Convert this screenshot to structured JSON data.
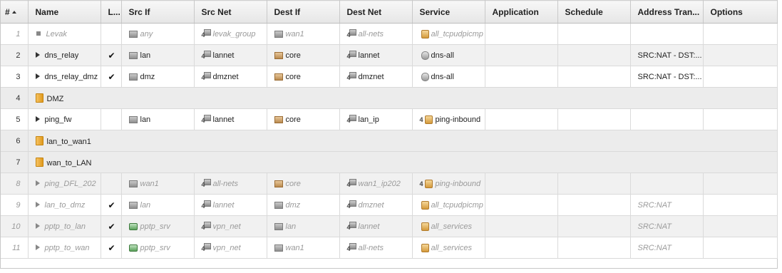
{
  "columns": [
    "#",
    "Name",
    "L...",
    "Src If",
    "Src Net",
    "Dest If",
    "Dest Net",
    "Service",
    "Application",
    "Schedule",
    "Address Tran...",
    "Options"
  ],
  "rows": [
    {
      "num": "1",
      "type": "rule",
      "disabled": true,
      "marker": "square",
      "name": "Levak",
      "log": false,
      "src_if": "any",
      "src_if_icon": "interface",
      "src_net": "levak_group",
      "dest_if": "wan1",
      "dest_if_icon": "interface",
      "dest_net": "all-nets",
      "service": "all_tcpudpicmp",
      "service_icon": "service",
      "nat": ""
    },
    {
      "num": "2",
      "type": "rule",
      "disabled": false,
      "marker": "arrow",
      "name": "dns_relay",
      "log": true,
      "src_if": "lan",
      "src_if_icon": "interface",
      "src_net": "lannet",
      "dest_if": "core",
      "dest_if_icon": "core",
      "dest_net": "lannet",
      "service": "dns-all",
      "service_icon": "service-round",
      "nat": "SRC:NAT - DST:..."
    },
    {
      "num": "3",
      "type": "rule",
      "disabled": false,
      "marker": "arrow",
      "name": "dns_relay_dmz",
      "log": true,
      "src_if": "dmz",
      "src_if_icon": "interface",
      "src_net": "dmznet",
      "dest_if": "core",
      "dest_if_icon": "core",
      "dest_net": "dmznet",
      "service": "dns-all",
      "service_icon": "service-round",
      "nat": "SRC:NAT - DST:..."
    },
    {
      "num": "4",
      "type": "folder",
      "name": "DMZ"
    },
    {
      "num": "5",
      "type": "rule",
      "disabled": false,
      "marker": "arrow",
      "name": "ping_fw",
      "log": false,
      "src_if": "lan",
      "src_if_icon": "interface",
      "src_net": "lannet",
      "dest_if": "core",
      "dest_if_icon": "core",
      "dest_net": "lan_ip",
      "service": "ping-inbound",
      "service_icon": "service-4",
      "nat": ""
    },
    {
      "num": "6",
      "type": "folder",
      "name": "lan_to_wan1"
    },
    {
      "num": "7",
      "type": "folder",
      "name": "wan_to_LAN"
    },
    {
      "num": "8",
      "type": "rule",
      "disabled": true,
      "marker": "arrow",
      "name": "ping_DFL_202",
      "log": false,
      "src_if": "wan1",
      "src_if_icon": "interface",
      "src_net": "all-nets",
      "dest_if": "core",
      "dest_if_icon": "core",
      "dest_net": "wan1_ip202",
      "service": "ping-inbound",
      "service_icon": "service-4",
      "nat": ""
    },
    {
      "num": "9",
      "type": "rule",
      "disabled": true,
      "marker": "arrow",
      "name": "lan_to_dmz",
      "log": true,
      "src_if": "lan",
      "src_if_icon": "interface",
      "src_net": "lannet",
      "dest_if": "dmz",
      "dest_if_icon": "interface",
      "dest_net": "dmznet",
      "service": "all_tcpudpicmp",
      "service_icon": "service",
      "nat": "SRC:NAT"
    },
    {
      "num": "10",
      "type": "rule",
      "disabled": true,
      "marker": "arrow",
      "name": "pptp_to_lan",
      "log": true,
      "src_if": "pptp_srv",
      "src_if_icon": "vpn",
      "src_net": "vpn_net",
      "dest_if": "lan",
      "dest_if_icon": "interface",
      "dest_net": "lannet",
      "service": "all_services",
      "service_icon": "service",
      "nat": "SRC:NAT"
    },
    {
      "num": "11",
      "type": "rule",
      "disabled": true,
      "marker": "arrow",
      "name": "pptp_to_wan",
      "log": true,
      "src_if": "pptp_srv",
      "src_if_icon": "vpn",
      "src_net": "vpn_net",
      "dest_if": "wan1",
      "dest_if_icon": "interface",
      "dest_net": "all-nets",
      "service": "all_services",
      "service_icon": "service",
      "nat": "SRC:NAT"
    }
  ],
  "check_glyph": "✔"
}
